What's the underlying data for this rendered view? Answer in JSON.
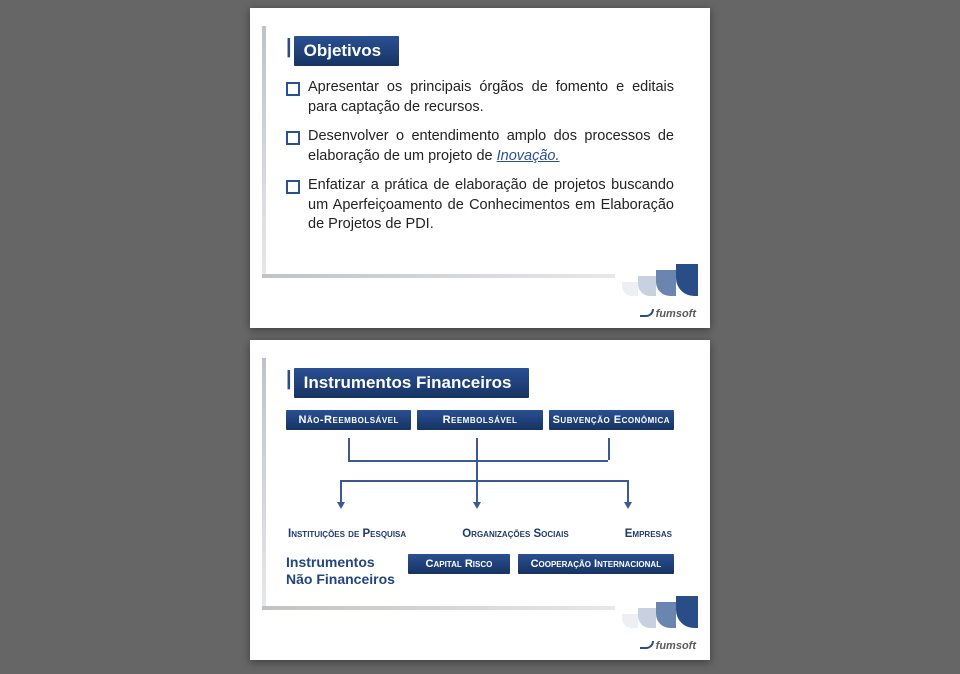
{
  "logo_text": "fumsoft",
  "slide1": {
    "title": "Objetivos",
    "bullets": [
      "Apresentar os principais órgãos de fomento e editais para captação de recursos.",
      "Desenvolver o entendimento amplo dos processos de elaboração de um projeto de ",
      "Enfatizar a prática de elaboração de projetos buscando um Aperfeiçoamento de Conhecimentos em Elaboração de Projetos de PDI."
    ],
    "innovation_word": "Inovação."
  },
  "slide2": {
    "title": "Instrumentos Financeiros",
    "categories": [
      "Não-Reembolsável",
      "Reembolsável",
      "Subvenção Econômica"
    ],
    "orgs": [
      "Instituições de Pesquisa",
      "Organizações Sociais",
      "Empresas"
    ],
    "footer_title_line1": "Instrumentos",
    "footer_title_line2": "Não Financeiros",
    "footer_box1": "Capital Risco",
    "footer_box2": "Cooperação Internacional"
  }
}
